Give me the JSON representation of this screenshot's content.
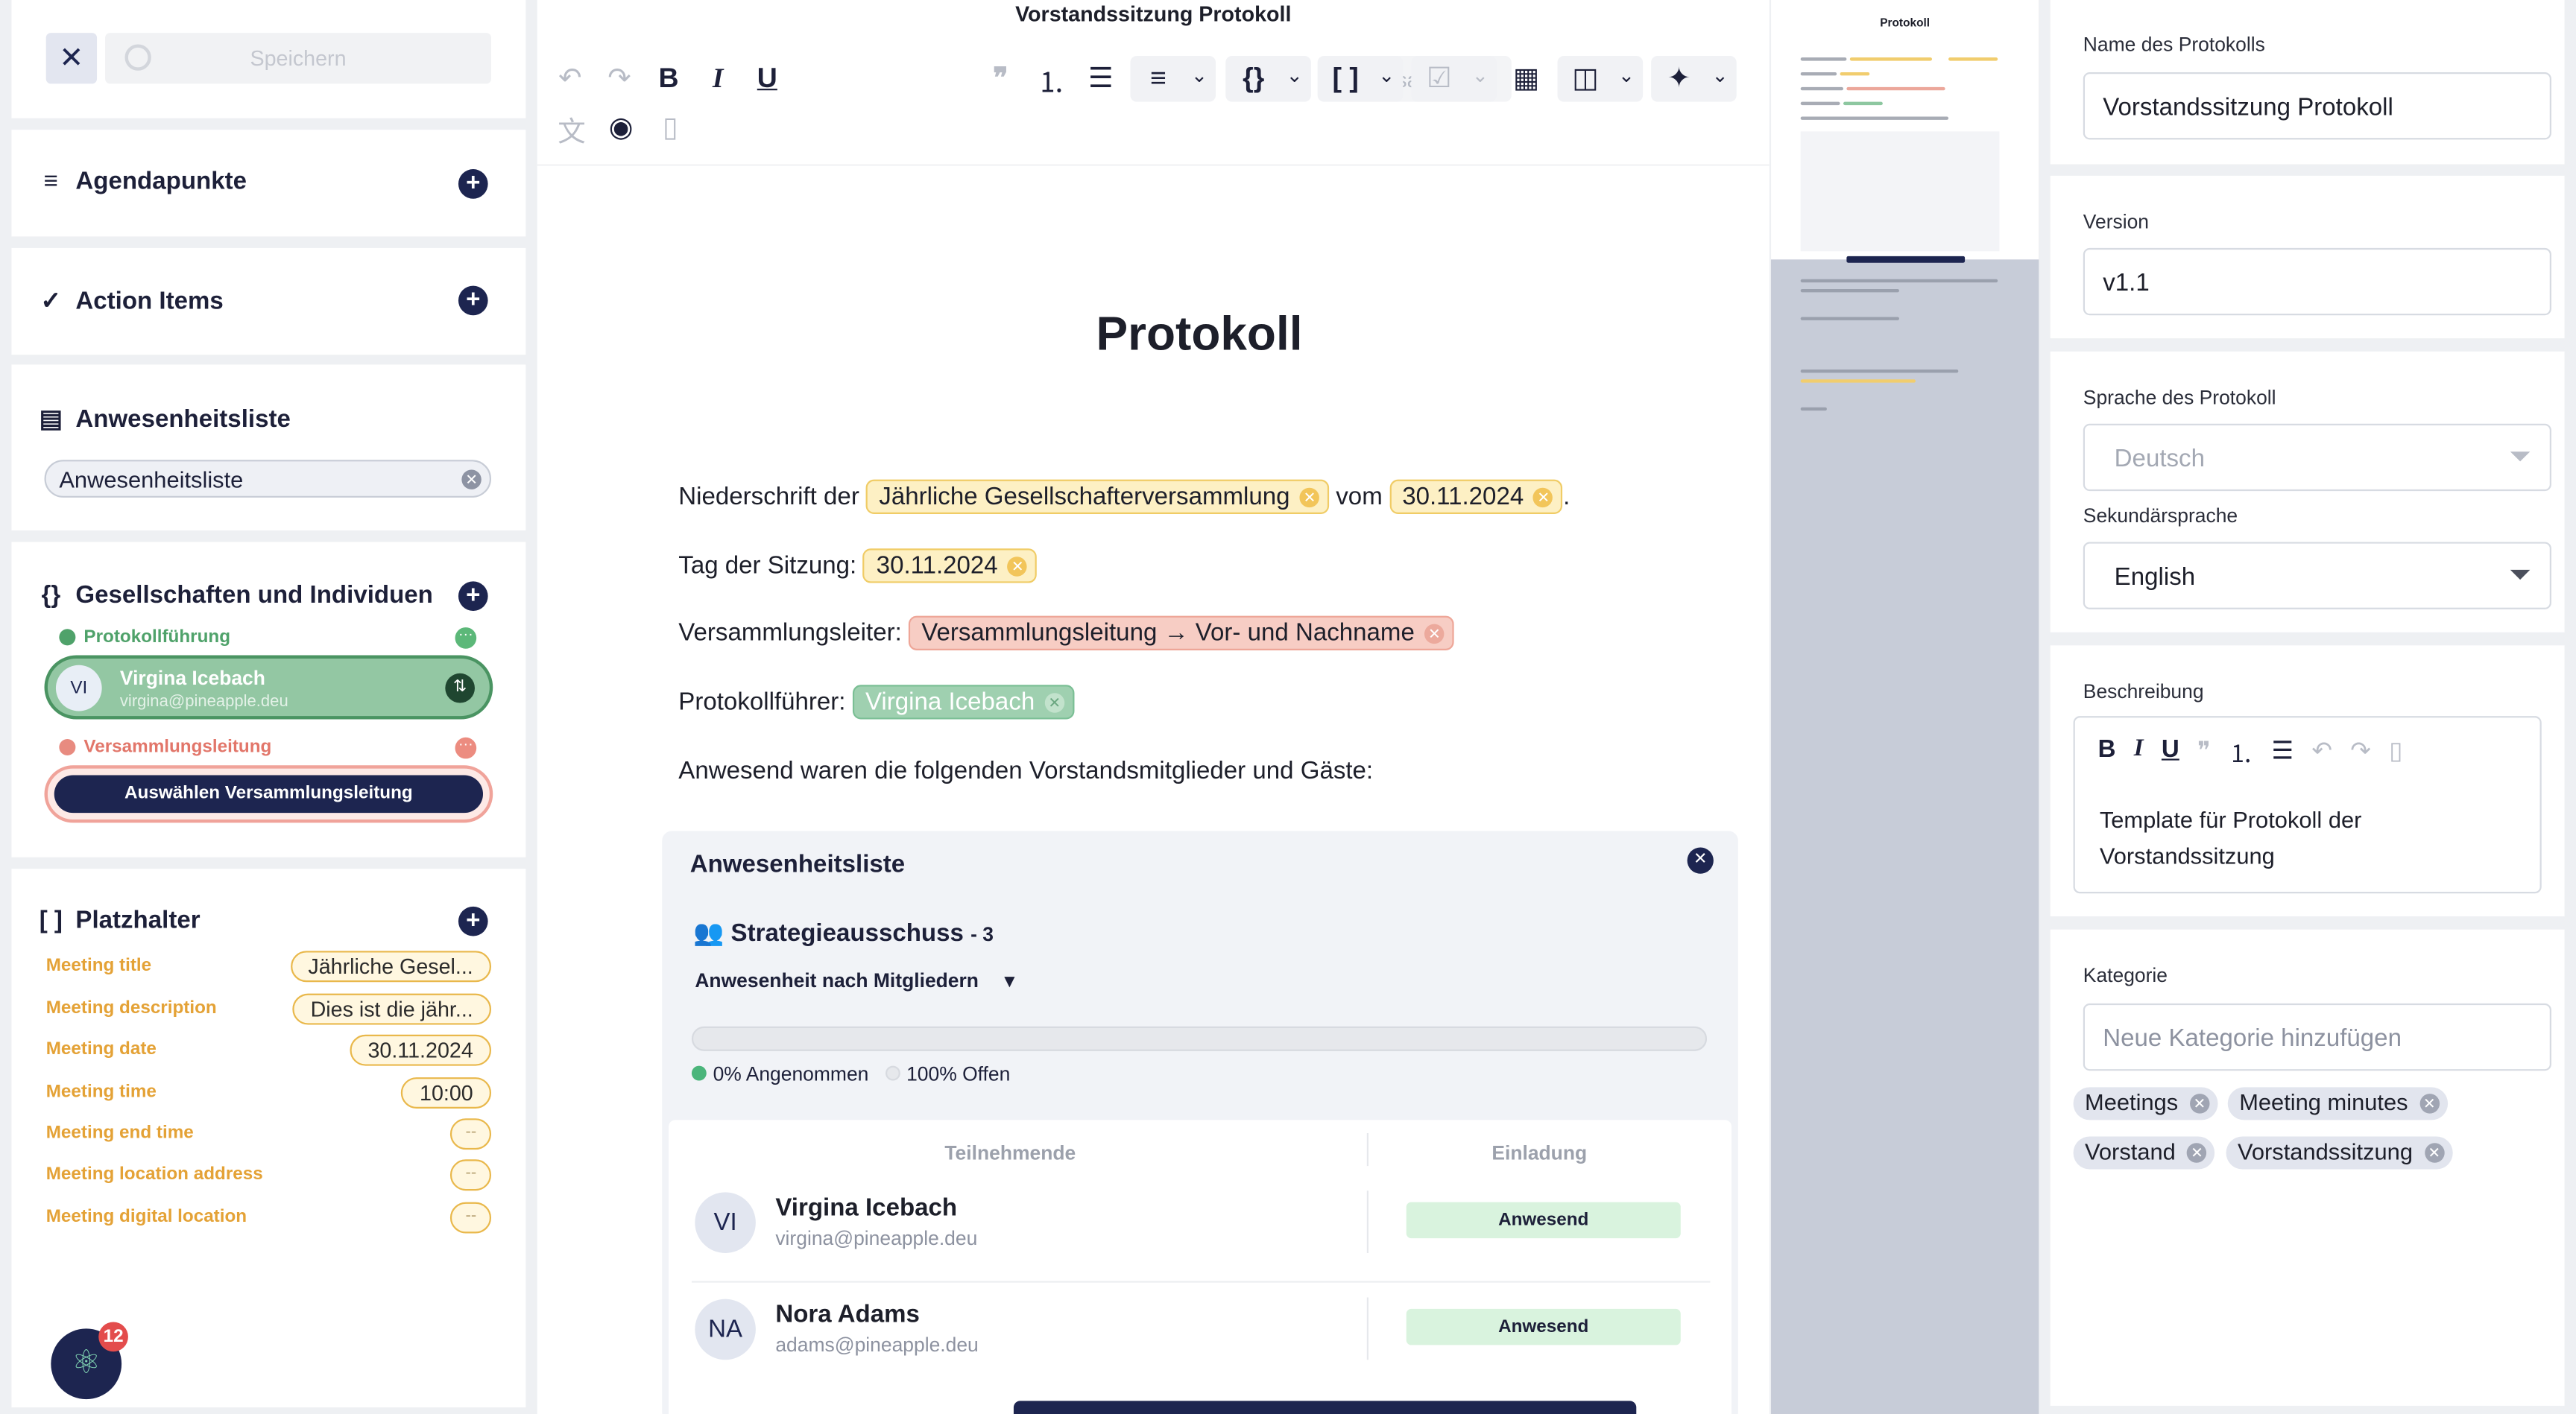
{
  "left": {
    "save_label": "Speichern",
    "sections": {
      "agenda": "Agendapunkte",
      "actions": "Action Items",
      "attendance": "Anwesenheitsliste",
      "companies": "Gesellschaften und Individuen",
      "placeholders": "Platzhalter"
    },
    "attendance_chip": "Anwesenheitsliste",
    "roles": {
      "minutes": "Protokollführung",
      "lead": "Versammlungsleitung"
    },
    "person": {
      "initials": "VI",
      "name": "Virgina Icebach",
      "email": "virgina@pineapple.deu"
    },
    "select_lead": "Auswählen Versammlungsleitung",
    "placeholder_rows": [
      {
        "key": "Meeting title",
        "value": "Jährliche Gesel..."
      },
      {
        "key": "Meeting description",
        "value": "Dies ist die jähr..."
      },
      {
        "key": "Meeting date",
        "value": "30.11.2024"
      },
      {
        "key": "Meeting time",
        "value": "10:00"
      },
      {
        "key": "Meeting end time",
        "value": "--"
      },
      {
        "key": "Meeting location address",
        "value": "--"
      },
      {
        "key": "Meeting digital location",
        "value": "--"
      }
    ],
    "notifications": "12"
  },
  "editor": {
    "doc_title": "Vorstandssitzung Protokoll",
    "block_style": "Absatz",
    "heading": "Protokoll",
    "line1": {
      "prefix": "Niederschrift der",
      "meeting": "Jährliche Gesellschafterversammlung",
      "mid": "vom",
      "date": "30.11.2024",
      "suffix": "."
    },
    "line2": {
      "prefix": "Tag der Sitzung:",
      "date": "30.11.2024"
    },
    "line3": {
      "prefix": "Versammlungsleiter:",
      "value": "Versammlungsleitung → Vor- und Nachname"
    },
    "line4": {
      "prefix": "Protokollführer:",
      "value": "Virgina Icebach"
    },
    "line5": "Anwesend waren die folgenden Vorstandsmitglieder und Gäste:",
    "attendance": {
      "title": "Anwesenheitsliste",
      "group": "Strategieausschuss",
      "group_count": "- 3",
      "dropdown": "Anwesenheit nach Mitgliedern",
      "accepted_pct": 0,
      "accepted_label": "0% Angenommen",
      "open_label": "100% Offen",
      "col_participants": "Teilnehmende",
      "col_invitation": "Einladung",
      "rows": [
        {
          "initials": "VI",
          "name": "Virgina Icebach",
          "email": "virgina@pineapple.deu",
          "status": "Anwesend"
        },
        {
          "initials": "NA",
          "name": "Nora Adams",
          "email": "adams@pineapple.deu",
          "status": "Anwesend"
        }
      ]
    },
    "colors": {
      "accent": "#1d2550",
      "yellow_tag": "#fdf0c4",
      "red_tag": "#f7cdc4",
      "green_tag": "#9fd0b0"
    }
  },
  "preview": {
    "title": "Protokoll"
  },
  "right": {
    "name_label": "Name des Protokolls",
    "name_value": "Vorstandssitzung Protokoll",
    "version_label": "Version",
    "version_value": "v1.1",
    "lang_label": "Sprache des Protokoll",
    "lang_value": "Deutsch",
    "lang2_label": "Sekundärsprache",
    "lang2_value": "English",
    "desc_label": "Beschreibung",
    "desc_value": "Template für Protokoll der Vorstandssitzung",
    "cat_label": "Kategorie",
    "cat_placeholder": "Neue Kategorie hinzufügen",
    "tags": [
      "Meetings",
      "Meeting minutes",
      "Vorstand",
      "Vorstandssitzung"
    ]
  }
}
